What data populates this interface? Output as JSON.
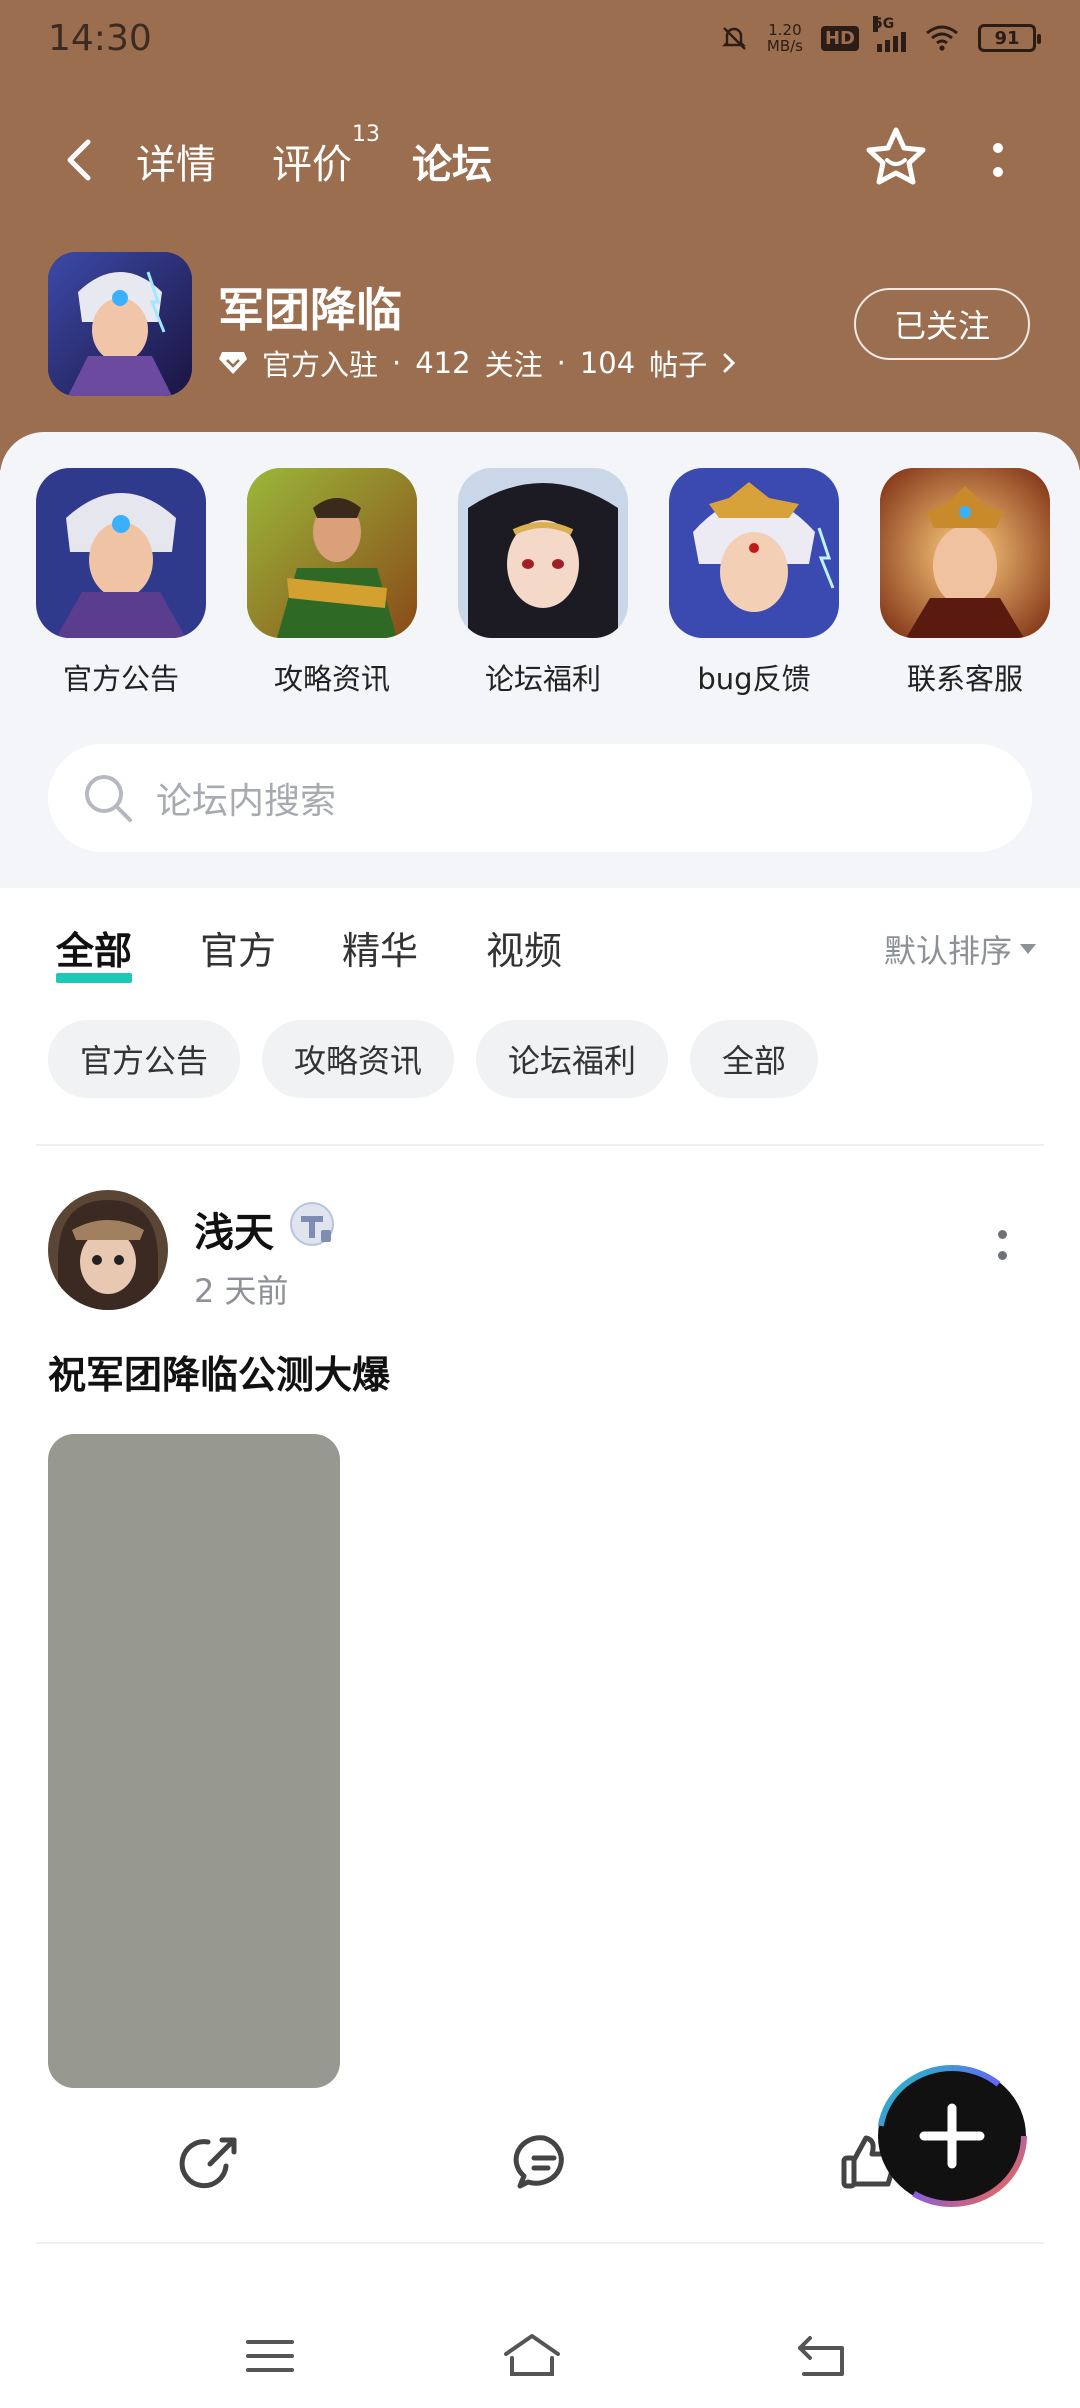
{
  "status_bar": {
    "time": "14:30",
    "net_speed_value": "1.20",
    "net_speed_unit": "MB/s",
    "hd": "HD",
    "network": "5G",
    "battery": "91"
  },
  "nav": {
    "tabs": [
      {
        "label": "详情"
      },
      {
        "label": "评价",
        "count": "13"
      },
      {
        "label": "论坛"
      }
    ],
    "active_tab": "论坛"
  },
  "game": {
    "name": "军团降临",
    "official": "官方入驻",
    "followers": "412",
    "followers_label": "关注",
    "posts": "104",
    "posts_label": "帖子",
    "follow_button": "已关注"
  },
  "shortcuts": [
    {
      "label": "官方公告"
    },
    {
      "label": "攻略资讯"
    },
    {
      "label": "论坛福利"
    },
    {
      "label": "bug反馈"
    },
    {
      "label": "联系客服"
    }
  ],
  "search": {
    "placeholder": "论坛内搜索"
  },
  "filter_tabs": [
    {
      "label": "全部"
    },
    {
      "label": "官方"
    },
    {
      "label": "精华"
    },
    {
      "label": "视频"
    }
  ],
  "sort_label": "默认排序",
  "chips": [
    {
      "label": "官方公告"
    },
    {
      "label": "攻略资讯"
    },
    {
      "label": "论坛福利"
    },
    {
      "label": "全部"
    }
  ],
  "post": {
    "author": "浅天",
    "time": "2 天前",
    "title": "祝军团降临公测大爆"
  },
  "colors": {
    "header_bg": "#9a6e4f",
    "accent": "#1ec8b6",
    "panel_bg": "#f3f5f8",
    "image_placeholder": "#979890"
  }
}
